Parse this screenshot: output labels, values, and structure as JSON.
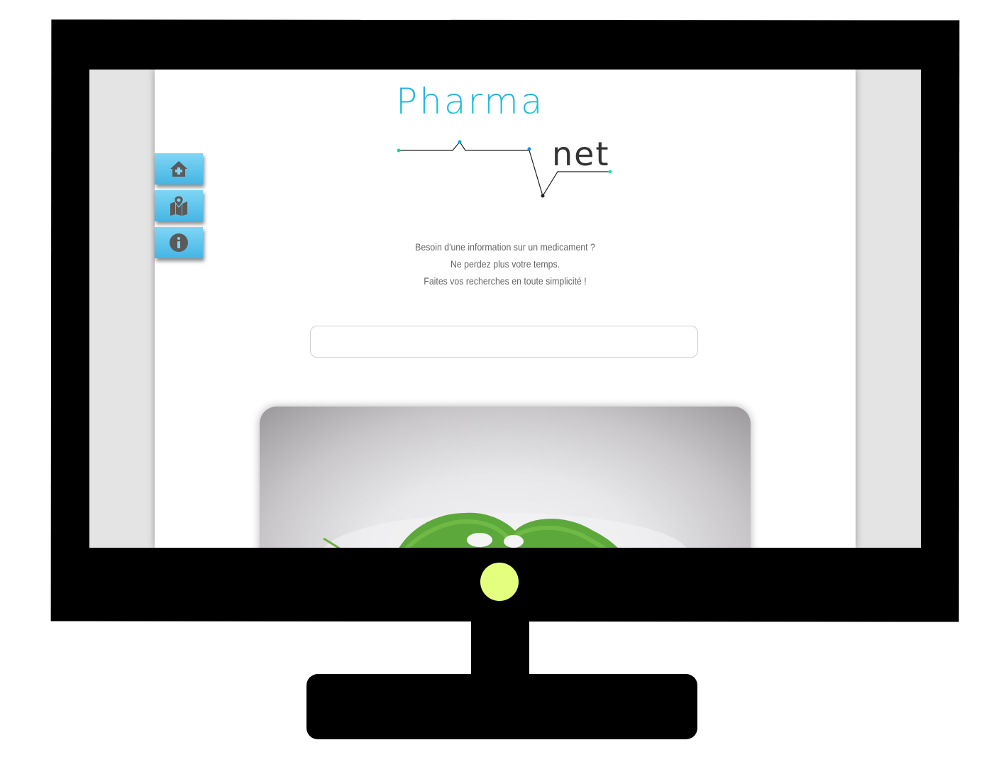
{
  "logo": {
    "word1": "Pharma",
    "word2": "net"
  },
  "nav": [
    {
      "name": "home",
      "icon": "home-plus-icon"
    },
    {
      "name": "map",
      "icon": "map-pin-icon"
    },
    {
      "name": "info",
      "icon": "info-icon"
    }
  ],
  "tagline": {
    "line1": "Besoin d'une information sur un medicament ?",
    "line2": "Ne perdez plus votre temps.",
    "line3": "Faites vos recherches en toute simplicité !"
  },
  "search": {
    "value": "",
    "placeholder": ""
  },
  "colors": {
    "accent_blue": "#2aa7f3",
    "accent_teal": "#18d0c4",
    "nav_button": "#5ac3ec",
    "led": "#e4ff7e"
  }
}
